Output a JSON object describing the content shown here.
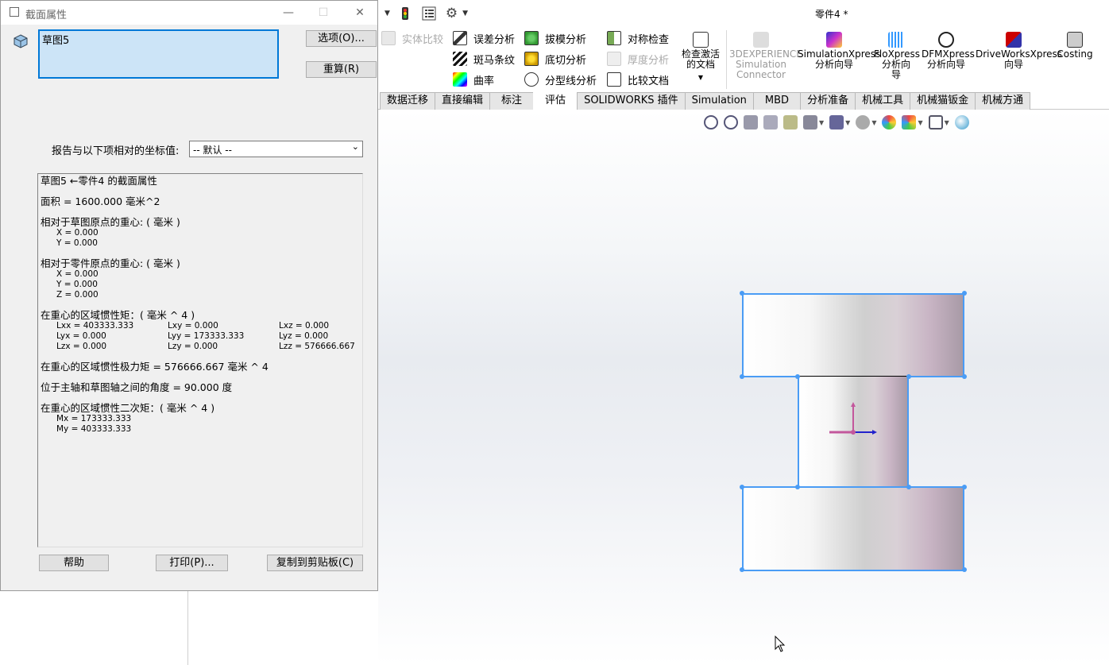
{
  "dialog": {
    "title": "截面属性",
    "selection": "草图5",
    "options_btn": "选项(O)...",
    "recalc_btn": "重算(R)",
    "coord_label": "报告与以下项相对的坐标值:",
    "coord_value": "-- 默认 --",
    "help_btn": "帮助",
    "print_btn": "打印(P)...",
    "copy_btn": "复制到剪贴板(C)",
    "report": {
      "header": "草图5 ←零件4 的截面属性",
      "area": "面积 = 1600.000 毫米^2",
      "centroid_sketch_title": "相对于草图原点的重心: ( 毫米 )",
      "centroid_sketch": [
        "X = 0.000",
        "Y = 0.000"
      ],
      "centroid_part_title": "相对于零件原点的重心: ( 毫米 )",
      "centroid_part": [
        "X = 0.000",
        "Y = 0.000",
        "Z = 0.000"
      ],
      "inertia_title": "在重心的区域惯性矩：( 毫米 ^ 4 )",
      "inertia": [
        [
          "Lxx = 403333.333",
          "Lxy = 0.000",
          "Lxz = 0.000"
        ],
        [
          "Lyx = 0.000",
          "Lyy = 173333.333",
          "Lyz = 0.000"
        ],
        [
          "Lzx = 0.000",
          "Lzy = 0.000",
          "Lzz = 576666.667"
        ]
      ],
      "polar": "在重心的区域惯性极力矩 = 576666.667 毫米 ^ 4",
      "angle": "位于主轴和草图轴之间的角度 = 90.000 度",
      "second_title": "在重心的区域惯性二次矩：( 毫米 ^ 4 )",
      "second": [
        "Mx = 173333.333",
        "My = 403333.333"
      ]
    }
  },
  "app": {
    "doc_title": "零件4 *",
    "ribbon": {
      "col0": [
        "实体比较"
      ],
      "col1": [
        "误差分析",
        "斑马条纹",
        "曲率"
      ],
      "col2": [
        "拔模分析",
        "底切分析",
        "分型线分析"
      ],
      "col3": [
        "对称检查",
        "厚度分析",
        "比较文档"
      ],
      "check_active": [
        "检查激活",
        "的文档"
      ],
      "exp": [
        "3DEXPERIENCE",
        "Simulation",
        "Connector"
      ],
      "simx": [
        "SimulationXpress",
        "分析向导"
      ],
      "flox": [
        "FloXpress",
        "分析向",
        "导"
      ],
      "dfmx": [
        "DFMXpress",
        "分析向导"
      ],
      "dwx": [
        "DriveWorksXpress",
        "向导"
      ],
      "costing": [
        "Costing"
      ]
    },
    "tabs": [
      "数据迁移",
      "直接编辑",
      "标注",
      "评估",
      "SOLIDWORKS 插件",
      "Simulation",
      "MBD",
      "分析准备",
      "机械工具",
      "机械猫钣金",
      "机械方通"
    ]
  }
}
